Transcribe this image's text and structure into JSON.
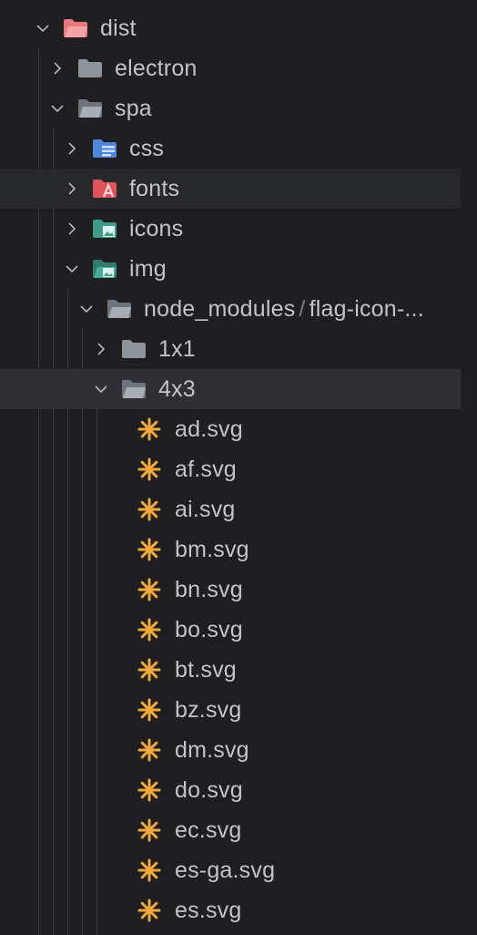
{
  "tree": {
    "dist": "dist",
    "electron": "electron",
    "spa": "spa",
    "css": "css",
    "fonts": "fonts",
    "icons": "icons",
    "img": "img",
    "compact_folder_first": "node_modules",
    "compact_separator": "/",
    "compact_folder_second": "flag-icon-...",
    "f1x1": "1x1",
    "f4x3": "4x3",
    "files": [
      "ad.svg",
      "af.svg",
      "ai.svg",
      "bm.svg",
      "bn.svg",
      "bo.svg",
      "bt.svg",
      "bz.svg",
      "dm.svg",
      "do.svg",
      "ec.svg",
      "es-ga.svg",
      "es.svg"
    ]
  },
  "colors": {
    "background": "#1f1f21",
    "hover_row": "#27282a",
    "selected_row": "#303034",
    "folder_grey": "#8d9399",
    "dist_folder": "#e8777b",
    "css_folder": "#4f86d9",
    "fonts_folder": "#e0535a",
    "image_folder": "#3f9b86",
    "svg_icon": "#f2a93b"
  },
  "icons": {
    "expanded": "chevron-down-icon",
    "collapsed": "chevron-right-icon",
    "svg_file": "asterisk-icon"
  }
}
